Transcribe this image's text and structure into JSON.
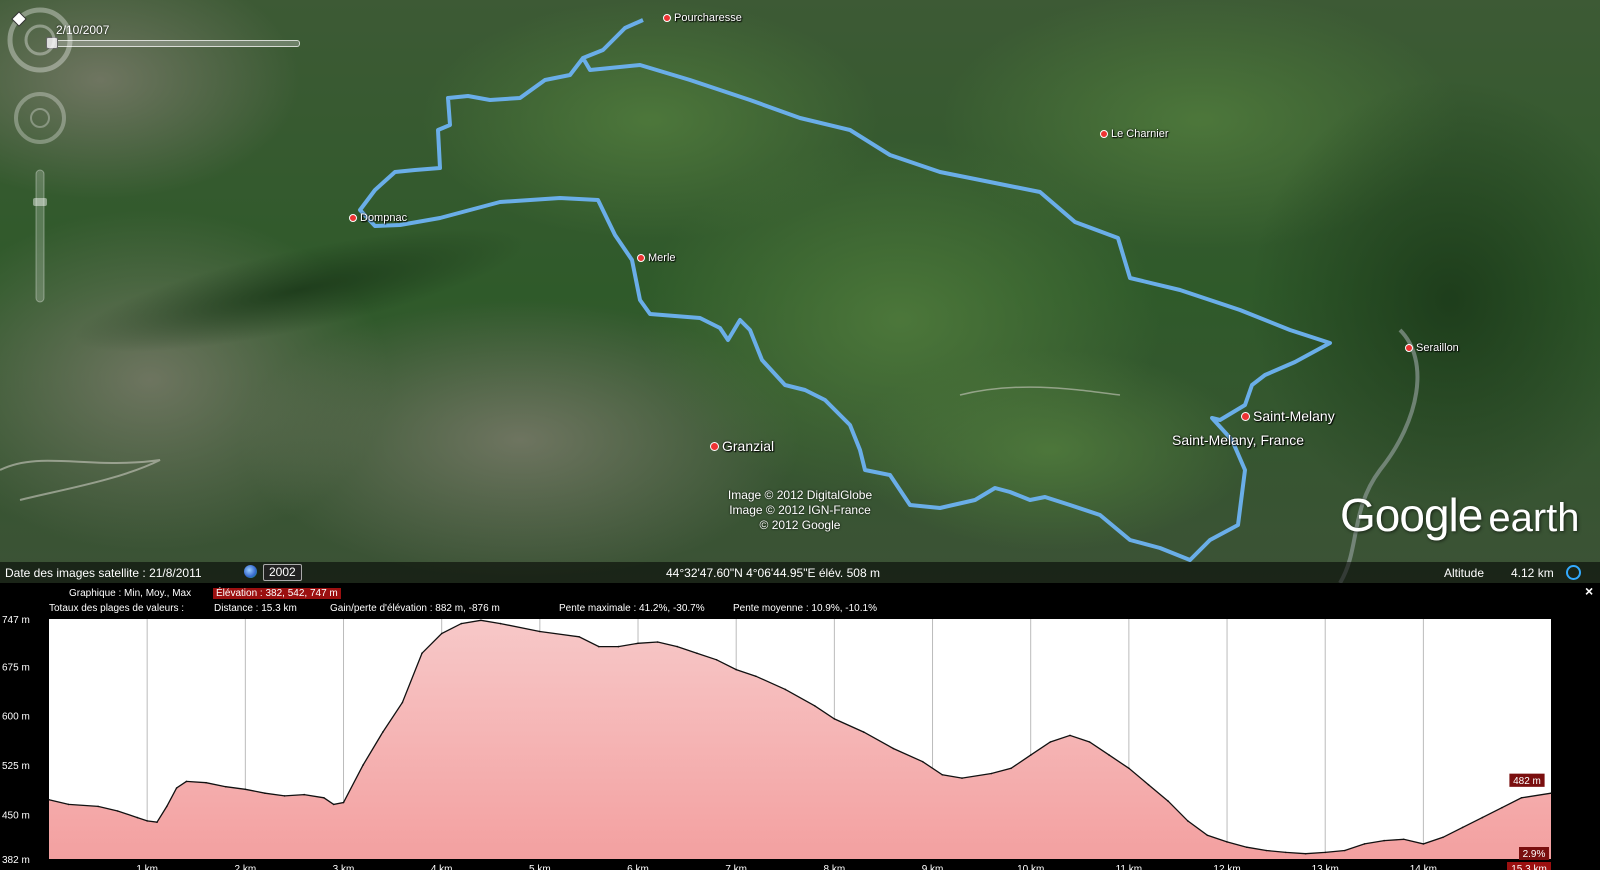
{
  "time_slider": {
    "date": "2/10/2007"
  },
  "places": [
    {
      "id": "pourcharesse",
      "name": "Pourcharesse"
    },
    {
      "id": "le-charnier",
      "name": "Le Charnier"
    },
    {
      "id": "dompnac",
      "name": "Dompnac"
    },
    {
      "id": "merle",
      "name": "Merle"
    },
    {
      "id": "seraillon",
      "name": "Seraillon"
    },
    {
      "id": "saint-melany",
      "name": "Saint-Melany"
    },
    {
      "id": "saint-melany-france",
      "name": "Saint-Melany, France"
    },
    {
      "id": "granzial",
      "name": "Granzial"
    }
  ],
  "copyright": [
    "Image © 2012 DigitalGlobe",
    "Image © 2012 IGN-France",
    "© 2012 Google"
  ],
  "logo": {
    "main": "Google",
    "suffix": "earth"
  },
  "status": {
    "imagery_date": "Date des images satellite : 21/8/2011",
    "year": "2002",
    "coords": "44°32'47.60\"N    4°06'44.95\"E  élév.  508 m",
    "altitude_label": "Altitude",
    "altitude_value": "4.12 km"
  },
  "profile": {
    "graph_label": "Graphique : Min, Moy., Max",
    "elevation_badge": "Élévation : 382, 542, 747 m",
    "totals_label": "Totaux des plages de valeurs :",
    "distance": "Distance : 15.3 km",
    "gain_loss": "Gain/perte d'élévation : 882 m, -876 m",
    "max_slope": "Pente maximale : 41.2%, -30.7%",
    "avg_slope": "Pente moyenne : 10.9%, -10.1%",
    "close": "×"
  },
  "colors": {
    "route": "#6aaee8",
    "fill_top": "#f7c8c8",
    "fill_bottom": "#f3a0a0",
    "marker": "#7a0f0f",
    "badge": "#9b1010"
  },
  "chart_data": {
    "type": "area",
    "title": "",
    "xlabel": "",
    "ylabel": "",
    "x_unit": "km",
    "xlim": [
      0,
      15.3
    ],
    "ylim": [
      382,
      747
    ],
    "y_ticks": [
      "747 m",
      "675 m",
      "600 m",
      "525 m",
      "450 m",
      "382 m"
    ],
    "y_tick_values": [
      747,
      675,
      600,
      525,
      450,
      382
    ],
    "x_ticks": [
      "1 km",
      "2 km",
      "3 km",
      "4 km",
      "5 km",
      "6 km",
      "7 km",
      "8 km",
      "9 km",
      "10 km",
      "11 km",
      "12 km",
      "13 km",
      "14 km"
    ],
    "x_tick_values": [
      1,
      2,
      3,
      4,
      5,
      6,
      7,
      8,
      9,
      10,
      11,
      12,
      13,
      14
    ],
    "end_x_label": "15.3 km",
    "marker_value_label": "482 m",
    "marker_slope_label": "2.9%",
    "grid": true,
    "series": [
      {
        "x": [
          0,
          0.2,
          0.5,
          0.7,
          0.9,
          1.0,
          1.1,
          1.2,
          1.3,
          1.4,
          1.6,
          1.8,
          2.0,
          2.2,
          2.4,
          2.6,
          2.8,
          2.9,
          3.0,
          3.2,
          3.4,
          3.6,
          3.8,
          4.0,
          4.2,
          4.4,
          4.6,
          5.0,
          5.4,
          5.6,
          5.8,
          6.0,
          6.2,
          6.4,
          6.6,
          6.8,
          7.0,
          7.2,
          7.5,
          7.8,
          8.0,
          8.3,
          8.6,
          8.9,
          9.1,
          9.3,
          9.6,
          9.8,
          10.0,
          10.2,
          10.4,
          10.6,
          10.8,
          11.0,
          11.2,
          11.4,
          11.6,
          11.8,
          12.0,
          12.2,
          12.4,
          12.6,
          12.8,
          13.0,
          13.2,
          13.4,
          13.6,
          13.8,
          14.0,
          14.2,
          14.4,
          14.6,
          14.8,
          15.0,
          15.3
        ],
        "y": [
          472,
          465,
          462,
          455,
          445,
          440,
          438,
          462,
          490,
          500,
          498,
          492,
          488,
          482,
          478,
          480,
          475,
          465,
          468,
          525,
          575,
          620,
          695,
          725,
          740,
          745,
          740,
          728,
          720,
          705,
          705,
          710,
          712,
          705,
          695,
          685,
          670,
          660,
          640,
          615,
          595,
          575,
          550,
          530,
          510,
          505,
          512,
          520,
          540,
          560,
          570,
          560,
          540,
          520,
          495,
          470,
          440,
          418,
          408,
          400,
          395,
          392,
          390,
          392,
          395,
          405,
          410,
          412,
          405,
          415,
          430,
          445,
          460,
          475,
          482
        ]
      }
    ]
  }
}
